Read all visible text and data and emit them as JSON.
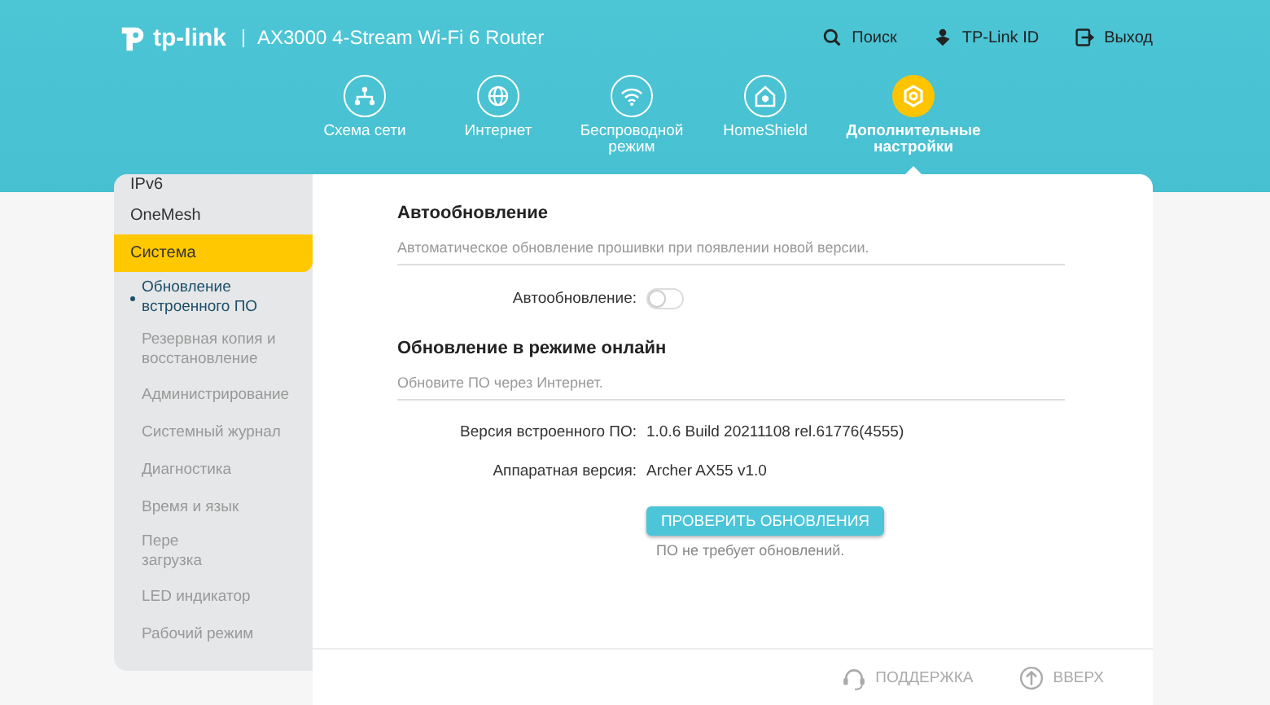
{
  "brand": {
    "logo": "tp-link",
    "model": "AX3000 4-Stream Wi-Fi 6 Router"
  },
  "top_links": [
    {
      "kind": "search",
      "label": "Поиск"
    },
    {
      "kind": "id",
      "label": "TP-Link ID"
    },
    {
      "kind": "logout",
      "label": "Выход"
    }
  ],
  "nav": [
    {
      "kind": "network-map",
      "label": "Схема сети",
      "selected": false
    },
    {
      "kind": "internet",
      "label": "Интернет",
      "selected": false
    },
    {
      "kind": "wireless",
      "label": "Беспроводной режим",
      "selected": false
    },
    {
      "kind": "homeshield",
      "label": "HomeShield",
      "selected": false
    },
    {
      "kind": "advanced",
      "label": "Дополнительные настройки",
      "selected": true
    }
  ],
  "sidebar": {
    "items": [
      {
        "label": "IPv6",
        "selected": false
      },
      {
        "label": "OneMesh",
        "selected": false
      },
      {
        "label": "Система",
        "selected": true,
        "children": [
          {
            "label": "Обновление встроенного ПО",
            "selected": true
          },
          {
            "label": "Резервная копия и восстановление",
            "selected": false
          },
          {
            "label": "Администрирование",
            "selected": false
          },
          {
            "label": "Системный журнал",
            "selected": false
          },
          {
            "label": "Диагностика",
            "selected": false
          },
          {
            "label": "Время и язык",
            "selected": false
          },
          {
            "label": "Пере\nзагрузка",
            "selected": false
          },
          {
            "label": "LED индикатор",
            "selected": false
          },
          {
            "label": "Рабочий режим",
            "selected": false
          }
        ]
      }
    ]
  },
  "sections": [
    {
      "title": "Автообновление",
      "description": "Автоматическое обновление прошивки при появлении новой версии.",
      "fields": [
        {
          "kind": "toggle",
          "label": "Автообновление:",
          "on": false
        }
      ]
    },
    {
      "title": "Обновление в режиме онлайн",
      "description": "Обновите ПО через Интернет.",
      "fields": [
        {
          "kind": "info",
          "label": "Версия встроенного ПО:",
          "value": "1.0.6 Build 20211108 rel.61776(4555)"
        },
        {
          "kind": "info",
          "label": "Аппаратная версия:",
          "value": "Archer AX55 v1.0"
        }
      ],
      "action": {
        "label": "ПРОВЕРИТЬ ОБНОВЛЕНИЯ"
      },
      "note": "ПО не требует обновлений."
    }
  ],
  "footer": [
    {
      "kind": "support",
      "label": "ПОДДЕРЖКА"
    },
    {
      "kind": "up",
      "label": "ВВЕРХ"
    }
  ]
}
